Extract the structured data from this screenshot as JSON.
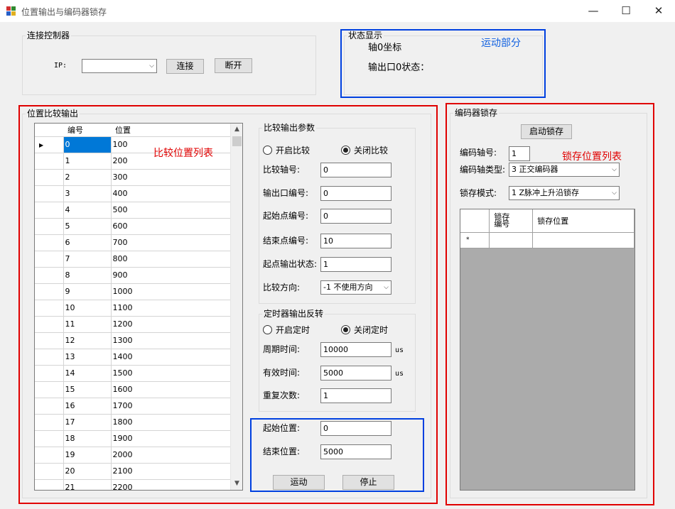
{
  "window": {
    "title": "位置输出与编码器锁存",
    "minimize": "—",
    "maximize": "☐",
    "close": "✕"
  },
  "connect": {
    "legend": "连接控制器",
    "ip_label": "IP:",
    "ip_value": "",
    "connect_btn": "连接",
    "disconnect_btn": "断开"
  },
  "status": {
    "legend": "状态显示",
    "axis_coord": "轴0坐标",
    "output_state": "输出口0状态：",
    "annotation": "运动部分"
  },
  "compare": {
    "legend": "位置比较输出",
    "annotation": "比较位置列表",
    "grid": {
      "headers": [
        "编号",
        "位置"
      ],
      "rows": [
        [
          "0",
          "100"
        ],
        [
          "1",
          "200"
        ],
        [
          "2",
          "300"
        ],
        [
          "3",
          "400"
        ],
        [
          "4",
          "500"
        ],
        [
          "5",
          "600"
        ],
        [
          "6",
          "700"
        ],
        [
          "7",
          "800"
        ],
        [
          "8",
          "900"
        ],
        [
          "9",
          "1000"
        ],
        [
          "10",
          "1100"
        ],
        [
          "11",
          "1200"
        ],
        [
          "12",
          "1300"
        ],
        [
          "13",
          "1400"
        ],
        [
          "14",
          "1500"
        ],
        [
          "15",
          "1600"
        ],
        [
          "16",
          "1700"
        ],
        [
          "17",
          "1800"
        ],
        [
          "18",
          "1900"
        ],
        [
          "19",
          "2000"
        ],
        [
          "20",
          "2100"
        ],
        [
          "21",
          "2200"
        ]
      ],
      "selected_row": 0
    },
    "params": {
      "legend": "比较输出参数",
      "radio_on": "开启比较",
      "radio_off": "关闭比较",
      "selected": "off",
      "axis_label": "比较轴号:",
      "axis_value": "0",
      "out_label": "输出口编号:",
      "out_value": "0",
      "start_label": "起始点编号:",
      "start_value": "0",
      "end_label": "结束点编号:",
      "end_value": "10",
      "start_state_label": "起点输出状态:",
      "start_state_value": "1",
      "dir_label": "比较方向:",
      "dir_value": "-1 不使用方向"
    },
    "timer": {
      "legend": "定时器输出反转",
      "radio_on": "开启定时",
      "radio_off": "关闭定时",
      "selected": "off",
      "period_label": "周期时间:",
      "period_value": "10000",
      "period_unit": "us",
      "valid_label": "有效时间:",
      "valid_value": "5000",
      "valid_unit": "us",
      "repeat_label": "重复次数:",
      "repeat_value": "1"
    },
    "motion": {
      "start_pos_label": "起始位置:",
      "start_pos_value": "0",
      "end_pos_label": "结束位置:",
      "end_pos_value": "5000",
      "move_btn": "运动",
      "stop_btn": "停止"
    }
  },
  "latch": {
    "legend": "编码器锁存",
    "start_btn": "启动锁存",
    "axis_label": "编码轴号:",
    "axis_value": "1",
    "annotation": "锁存位置列表",
    "type_label": "编码轴类型:",
    "type_value": "3 正交编码器",
    "mode_label": "锁存模式:",
    "mode_value": "1 Z脉冲上升沿锁存",
    "grid": {
      "header_num_line1": "锁存",
      "header_num_line2": "编号",
      "header_pos": "锁存位置",
      "new_row_marker": "*"
    }
  },
  "colors": {
    "annotation_red": "#e00000",
    "annotation_blue": "#0040e0",
    "selection": "#0078d7"
  }
}
